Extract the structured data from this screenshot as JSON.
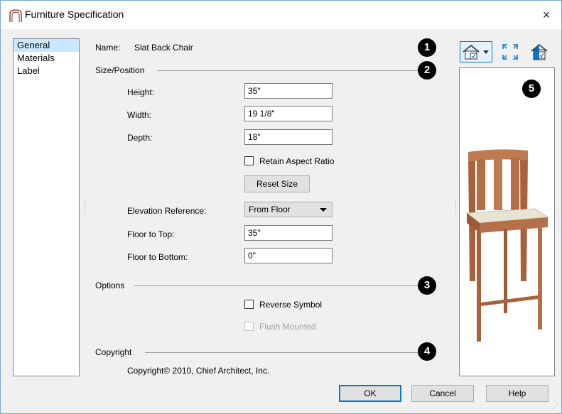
{
  "window": {
    "title": "Furniture Specification",
    "close_glyph": "×"
  },
  "nav": {
    "items": [
      {
        "label": "General"
      },
      {
        "label": "Materials"
      },
      {
        "label": "Label"
      }
    ]
  },
  "general": {
    "name_label": "Name:",
    "name_value": "Slat Back Chair",
    "size_section": "Size/Position",
    "height_label": "Height:",
    "height_value": "35\"",
    "width_label": "Width:",
    "width_value": "19 1/8\"",
    "depth_label": "Depth:",
    "depth_value": "18\"",
    "retain_label": "Retain Aspect Ratio",
    "reset_label": "Reset Size",
    "elev_label": "Elevation Reference:",
    "elev_value": "From Floor",
    "floor_top_label": "Floor to Top:",
    "floor_top_value": "35\"",
    "floor_bottom_label": "Floor to Bottom:",
    "floor_bottom_value": "0\"",
    "options_section": "Options",
    "reverse_label": "Reverse Symbol",
    "flush_label": "Flush Mounted",
    "copyright_section": "Copyright",
    "copyright_text": "Copyright© 2010, Chief Architect, Inc."
  },
  "badges": [
    "1",
    "2",
    "3",
    "4",
    "5"
  ],
  "toolbar": {
    "icons": [
      "view-type-icon",
      "fill-window-icon",
      "render-icon"
    ]
  },
  "footer": {
    "ok": "OK",
    "cancel": "Cancel",
    "help": "Help"
  },
  "colors": {
    "accent": "#0078d7",
    "selection": "#cce8ff",
    "wood": "#b5704a",
    "cushion": "#e7e4d4"
  }
}
